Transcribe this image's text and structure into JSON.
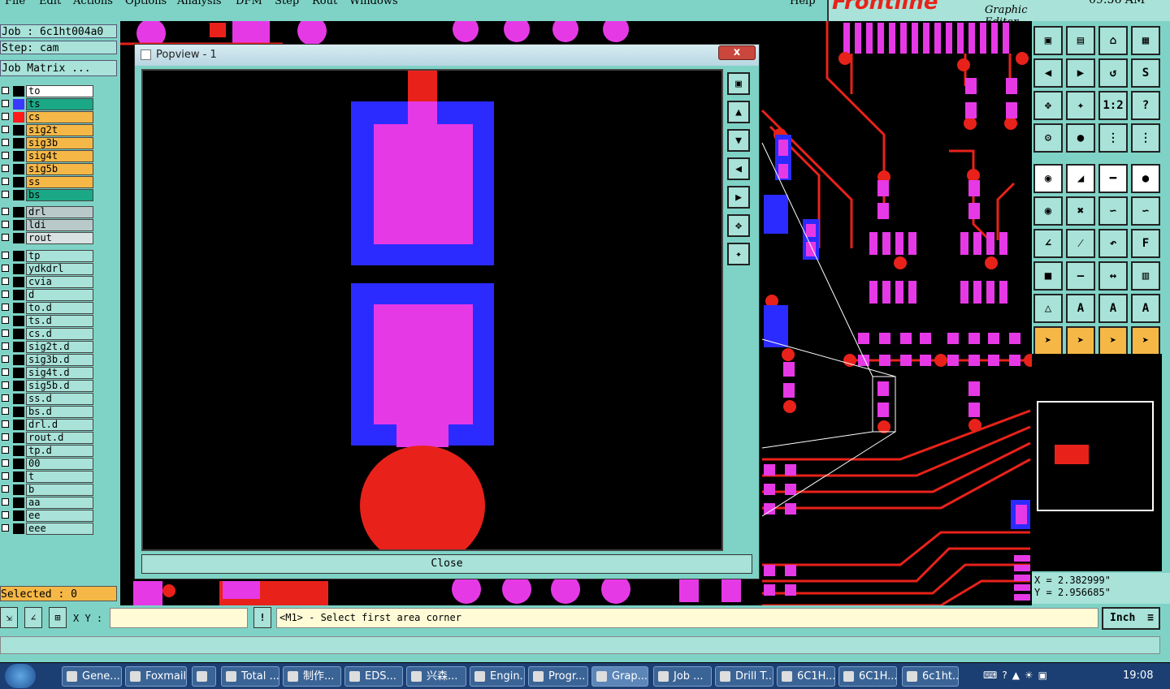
{
  "menu": [
    "File",
    "Edit",
    "Actions",
    "Options",
    "Analysis",
    "DFM",
    "Step",
    "Rout",
    "Windows"
  ],
  "help": "Help",
  "brand": {
    "logo": "Frontline",
    "subtitle": "Graphic Editor",
    "time": "09:56 AM"
  },
  "job": {
    "job_label": "Job : 6c1ht004a0",
    "step_label": "Step: cam",
    "matrix_button": "Job Matrix ..."
  },
  "layers_board": [
    {
      "name": "to",
      "color": "#ffffff",
      "swatch": "#000000"
    },
    {
      "name": "ts",
      "color": "#1aa886",
      "swatch": "#3a3aff"
    },
    {
      "name": "cs",
      "color": "#f5b847",
      "swatch": "#ff1a1a"
    },
    {
      "name": "sig2t",
      "color": "#f5b847",
      "swatch": "#000000"
    },
    {
      "name": "sig3b",
      "color": "#f5b847",
      "swatch": "#000000"
    },
    {
      "name": "sig4t",
      "color": "#f5b847",
      "swatch": "#000000"
    },
    {
      "name": "sig5b",
      "color": "#f5b847",
      "swatch": "#000000"
    },
    {
      "name": "ss",
      "color": "#f5b847",
      "swatch": "#000000"
    },
    {
      "name": "bs",
      "color": "#1aa886",
      "swatch": "#000000"
    }
  ],
  "layers_drill": [
    {
      "name": "drl",
      "color": "#b9c9c9"
    },
    {
      "name": "ldi",
      "color": "#b9c9c9"
    },
    {
      "name": "rout",
      "color": "#d9e2e2"
    }
  ],
  "layers_misc": [
    "tp",
    "ydkdrl",
    "cvia",
    "d",
    "to.d",
    "ts.d",
    "cs.d",
    "sig2t.d",
    "sig3b.d",
    "sig4t.d",
    "sig5b.d",
    "ss.d",
    "bs.d",
    "drl.d",
    "rout.d",
    "tp.d",
    "00",
    "t",
    "b",
    "aa",
    "ee",
    "eee"
  ],
  "selected": "Selected : 0",
  "popup": {
    "title": "Popview - 1",
    "close_x": "x",
    "close_button": "Close"
  },
  "coords": {
    "x": "X = 2.382999\"",
    "y": "Y = 2.956685\""
  },
  "command": {
    "xy_label": "X Y :",
    "xy_value": "",
    "prompt": "<M1> - Select first area corner",
    "unit": "Inch"
  },
  "taskbar": {
    "items": [
      "Gene...",
      "Foxmail",
      "",
      "Total ...",
      "制作...",
      "EDS...",
      "兴森...",
      "Engin...",
      "Progr...",
      "Grap...",
      "Job ...",
      "Drill T...",
      "6C1H...",
      "6C1H...",
      "6c1ht..."
    ],
    "clock": "19:08"
  },
  "colors": {
    "panel": "#7fd3c6",
    "pad": "#e639e6",
    "mask": "#2b2bff",
    "copper": "#ff1a1a",
    "accent": "#f5b847"
  }
}
